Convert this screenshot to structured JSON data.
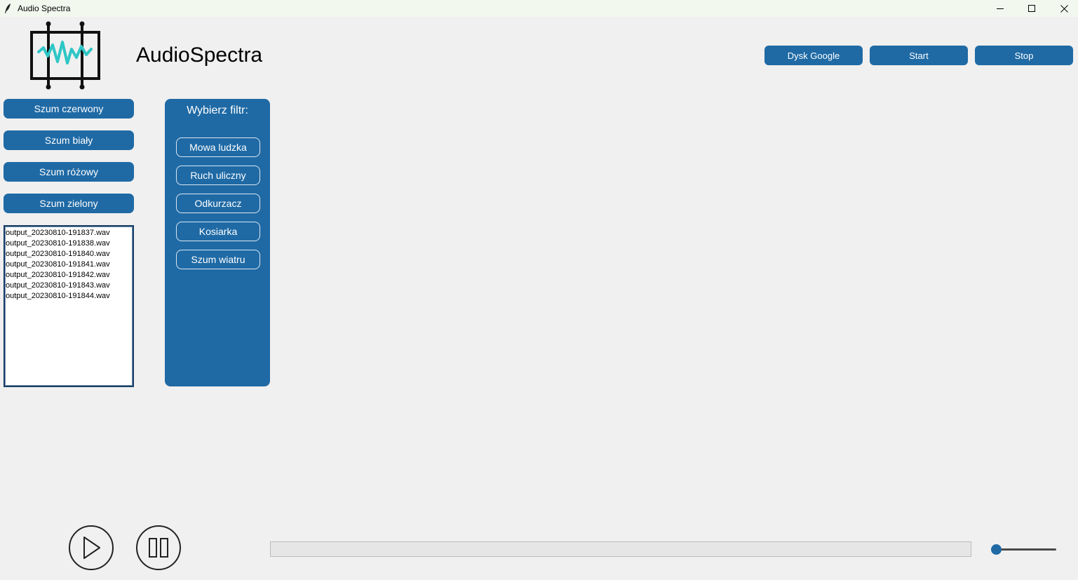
{
  "window": {
    "title": "Audio Spectra"
  },
  "header": {
    "app_title": "AudioSpectra",
    "buttons": {
      "google_drive": "Dysk Google",
      "start": "Start",
      "stop": "Stop"
    }
  },
  "noise_buttons": [
    "Szum czerwony",
    "Szum biały",
    "Szum różowy",
    "Szum zielony"
  ],
  "file_list": [
    "output_20230810-191837.wav",
    "output_20230810-191838.wav",
    "output_20230810-191840.wav",
    "output_20230810-191841.wav",
    "output_20230810-191842.wav",
    "output_20230810-191843.wav",
    "output_20230810-191844.wav"
  ],
  "filter_panel": {
    "title": "Wybierz filtr:",
    "filters": [
      "Mowa ludzka",
      "Ruch uliczny",
      "Odkurzacz",
      "Kosiarka",
      "Szum wiatru"
    ]
  },
  "player": {
    "progress_fraction": 0,
    "volume_fraction": 0
  },
  "icons": {
    "play": "play-icon",
    "pause": "pause-icon",
    "logo": "audio-waveform-logo-icon",
    "window_app": "feather-icon"
  },
  "colors": {
    "accent": "#1f6aa5",
    "background": "#f0f0f0",
    "logo_wave": "#2fc6c6"
  }
}
